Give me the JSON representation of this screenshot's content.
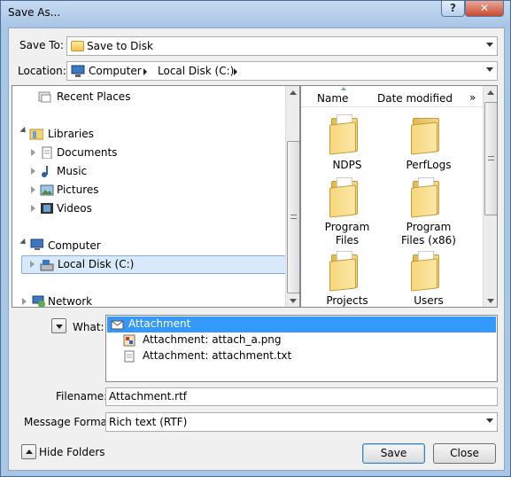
{
  "window": {
    "title": "Save As...",
    "help_label": "?",
    "close_label": "✕"
  },
  "save_to": {
    "label": "Save To:",
    "value": "Save to Disk"
  },
  "location": {
    "label": "Location:",
    "crumbs": [
      "Computer",
      "Local Disk (C:)"
    ]
  },
  "tree": {
    "recent_places": "Recent Places",
    "libraries": "Libraries",
    "documents": "Documents",
    "music": "Music",
    "pictures": "Pictures",
    "videos": "Videos",
    "computer": "Computer",
    "local_disk": "Local Disk (C:)",
    "network": "Network"
  },
  "columns": {
    "name": "Name",
    "date_modified": "Date modified",
    "more": "»"
  },
  "folders": [
    {
      "name": "NDPS",
      "line2": ""
    },
    {
      "name": "PerfLogs",
      "line2": ""
    },
    {
      "name": "Program",
      "line2": "Files"
    },
    {
      "name": "Program",
      "line2": "Files (x86)"
    },
    {
      "name": "Projects",
      "line2": ""
    },
    {
      "name": "Users",
      "line2": ""
    }
  ],
  "what": {
    "label": "What:",
    "items": [
      "Attachment",
      "Attachment: attach_a.png",
      "Attachment: attachment.txt"
    ]
  },
  "filename": {
    "label": "Filename:",
    "value": "Attachment.rtf"
  },
  "message_format": {
    "label": "Message Format:",
    "value": "Rich text (RTF)"
  },
  "hide_folders": {
    "label": "Hide Folders"
  },
  "buttons": {
    "save": "Save",
    "close": "Close"
  },
  "colors": {
    "selection": "#3399ff",
    "title_bar": "#a9c6e6",
    "dialog_bg": "#f0f0f0"
  }
}
